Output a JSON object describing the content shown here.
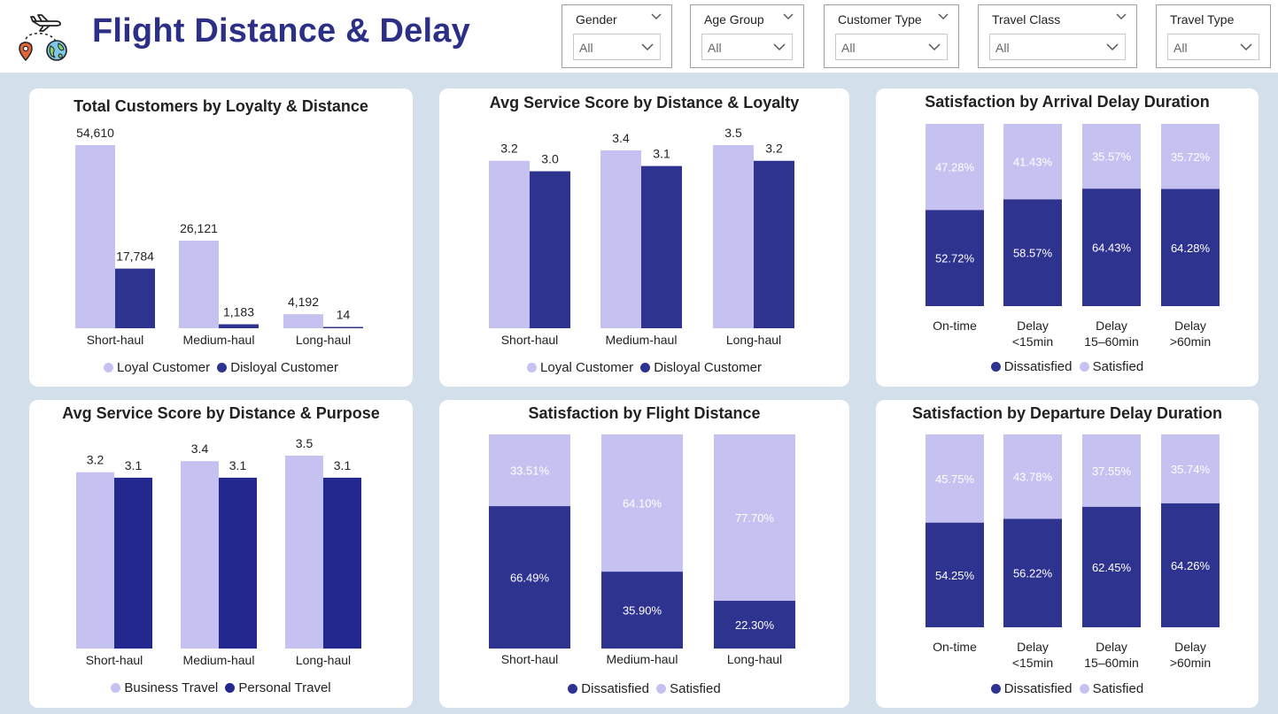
{
  "header": {
    "title": "Flight Distance & Delay",
    "logo_icon": "airplane-globe-route-icon"
  },
  "colors": {
    "light": "#c5c2f2",
    "dark": "#2e3390",
    "dark_alt": "#23288f",
    "navy_title": "#2b2f86",
    "page_bg": "#d4dfec"
  },
  "slicers": [
    {
      "label": "Gender",
      "value": "All"
    },
    {
      "label": "Age Group",
      "value": "All"
    },
    {
      "label": "Customer Type",
      "value": "All"
    },
    {
      "label": "Travel Class",
      "value": "All"
    },
    {
      "label": "Travel Type",
      "value": "All"
    }
  ],
  "chart_data": [
    {
      "id": "loyalty_distance_count",
      "type": "bar",
      "title": "Total Customers by Loyalty & Distance",
      "categories": [
        "Short-haul",
        "Medium-haul",
        "Long-haul"
      ],
      "series": [
        {
          "name": "Loyal Customer",
          "values": [
            54610,
            26121,
            4192
          ],
          "labels": [
            "54,610",
            "26,121",
            "4,192"
          ],
          "color": "#c5c2f2"
        },
        {
          "name": "Disloyal Customer",
          "values": [
            17784,
            1183,
            14
          ],
          "labels": [
            "17,784",
            "1,183",
            "14"
          ],
          "color": "#2e3390"
        }
      ],
      "ylim": [
        0,
        54610
      ],
      "legend": [
        "Loyal Customer",
        "Disloyal Customer"
      ],
      "legend_position": "bottom"
    },
    {
      "id": "service_distance_loyalty",
      "type": "bar",
      "title": "Avg Service Score by Distance & Loyalty",
      "categories": [
        "Short-haul",
        "Medium-haul",
        "Long-haul"
      ],
      "series": [
        {
          "name": "Loyal Customer",
          "values": [
            3.2,
            3.4,
            3.5
          ],
          "labels": [
            "3.2",
            "3.4",
            "3.5"
          ],
          "color": "#c5c2f2"
        },
        {
          "name": "Disloyal Customer",
          "values": [
            3.0,
            3.1,
            3.2
          ],
          "labels": [
            "3.0",
            "3.1",
            "3.2"
          ],
          "color": "#2e3390"
        }
      ],
      "ylim": [
        0,
        3.5
      ],
      "legend": [
        "Loyal Customer",
        "Disloyal Customer"
      ],
      "legend_position": "bottom"
    },
    {
      "id": "satisfaction_arrival_delay",
      "type": "bar",
      "stacked": "percent",
      "title": "Satisfaction by Arrival Delay Duration",
      "categories": [
        [
          "On-time"
        ],
        [
          "Delay",
          "<15min"
        ],
        [
          "Delay",
          "15–60min"
        ],
        [
          "Delay",
          ">60min"
        ]
      ],
      "series": [
        {
          "name": "Dissatisfied",
          "values": [
            52.72,
            58.57,
            64.43,
            64.28
          ],
          "labels": [
            "52.72%",
            "58.57%",
            "64.43%",
            "64.28%"
          ],
          "color": "#2e3390"
        },
        {
          "name": "Satisfied",
          "values": [
            47.28,
            41.43,
            35.57,
            35.72
          ],
          "labels": [
            "47.28%",
            "41.43%",
            "35.57%",
            "35.72%"
          ],
          "color": "#c5c2f2"
        }
      ],
      "legend": [
        "Dissatisfied",
        "Satisfied"
      ],
      "legend_position": "bottom"
    },
    {
      "id": "service_distance_purpose",
      "type": "bar",
      "title": "Avg Service Score by Distance & Purpose",
      "categories": [
        "Short-haul",
        "Medium-haul",
        "Long-haul"
      ],
      "series": [
        {
          "name": "Business Travel",
          "values": [
            3.2,
            3.4,
            3.5
          ],
          "labels": [
            "3.2",
            "3.4",
            "3.5"
          ],
          "color": "#c5c2f2"
        },
        {
          "name": "Personal Travel",
          "values": [
            3.1,
            3.1,
            3.1
          ],
          "labels": [
            "3.1",
            "3.1",
            "3.1"
          ],
          "color": "#23288f"
        }
      ],
      "ylim": [
        0,
        3.5
      ],
      "legend": [
        "Business Travel",
        "Personal Travel"
      ],
      "legend_position": "bottom"
    },
    {
      "id": "satisfaction_distance",
      "type": "bar",
      "stacked": "percent",
      "title": "Satisfaction by Flight Distance",
      "categories": [
        [
          "Short-haul"
        ],
        [
          "Medium-haul"
        ],
        [
          "Long-haul"
        ]
      ],
      "series": [
        {
          "name": "Dissatisfied",
          "values": [
            66.49,
            35.9,
            22.3
          ],
          "labels": [
            "66.49%",
            "35.90%",
            "22.30%"
          ],
          "color": "#2e3390"
        },
        {
          "name": "Satisfied",
          "values": [
            33.51,
            64.1,
            77.7
          ],
          "labels": [
            "33.51%",
            "64.10%",
            "77.70%"
          ],
          "color": "#c5c2f2"
        }
      ],
      "legend": [
        "Dissatisfied",
        "Satisfied"
      ],
      "legend_position": "bottom"
    },
    {
      "id": "satisfaction_departure_delay",
      "type": "bar",
      "stacked": "percent",
      "title": "Satisfaction by Departure Delay Duration",
      "categories": [
        [
          "On-time"
        ],
        [
          "Delay",
          "<15min"
        ],
        [
          "Delay",
          "15–60min"
        ],
        [
          "Delay",
          ">60min"
        ]
      ],
      "series": [
        {
          "name": "Dissatisfied",
          "values": [
            54.25,
            56.22,
            62.45,
            64.26
          ],
          "labels": [
            "54.25%",
            "56.22%",
            "62.45%",
            "64.26%"
          ],
          "color": "#2e3390"
        },
        {
          "name": "Satisfied",
          "values": [
            45.75,
            43.78,
            37.55,
            35.74
          ],
          "labels": [
            "45.75%",
            "43.78%",
            "37.55%",
            "35.74%"
          ],
          "color": "#c5c2f2"
        }
      ],
      "legend": [
        "Dissatisfied",
        "Satisfied"
      ],
      "legend_position": "bottom"
    }
  ]
}
